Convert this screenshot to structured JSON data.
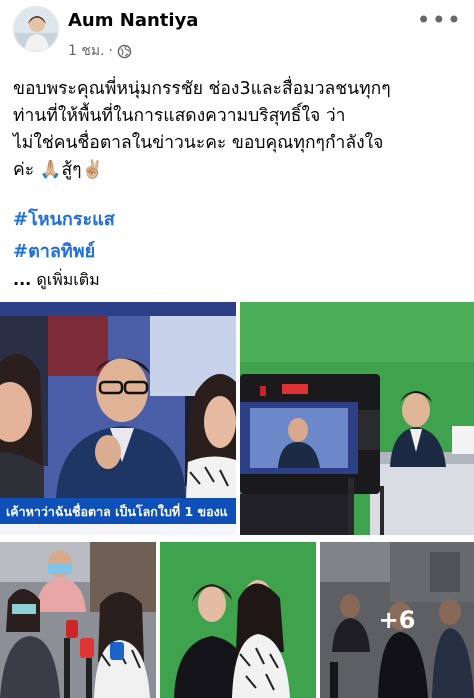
{
  "post": {
    "author": "Aum Nantiya",
    "time": "1 ชม.",
    "separator": "·",
    "more": "•••",
    "text_lines": [
      "ขอบพระคุณพี่หนุ่มกรรชัย ช่อง3และสื่อมวลชนทุกๆ",
      "ท่านที่ให้พื้นที่ในการแสดงความบริสุทธิ์ใจ ว่า",
      "ไม่ใช่คนชื่อตาลในข่าวนะคะ ขอบคุณทุกๆกำลังใจ",
      "ค่ะ 🙏🏼สู้ๆ✌🏼"
    ],
    "hashtags": [
      "#โหนกระแส",
      "#ตาลทิพย์"
    ],
    "see_more_prefix": "...",
    "see_more": "ดูเพิ่มเติม"
  },
  "photos": {
    "tv_caption": "เค้าหาว่าฉันชื่อตาล เป็นโลกใบที่ 1 ของแ",
    "more_count": "+6"
  },
  "icons": {
    "globe": "globe-icon",
    "more": "more-options-icon"
  },
  "colors": {
    "hashtag": "#216fdb",
    "meta": "#65676b",
    "green_screen": "#3fa34d"
  }
}
